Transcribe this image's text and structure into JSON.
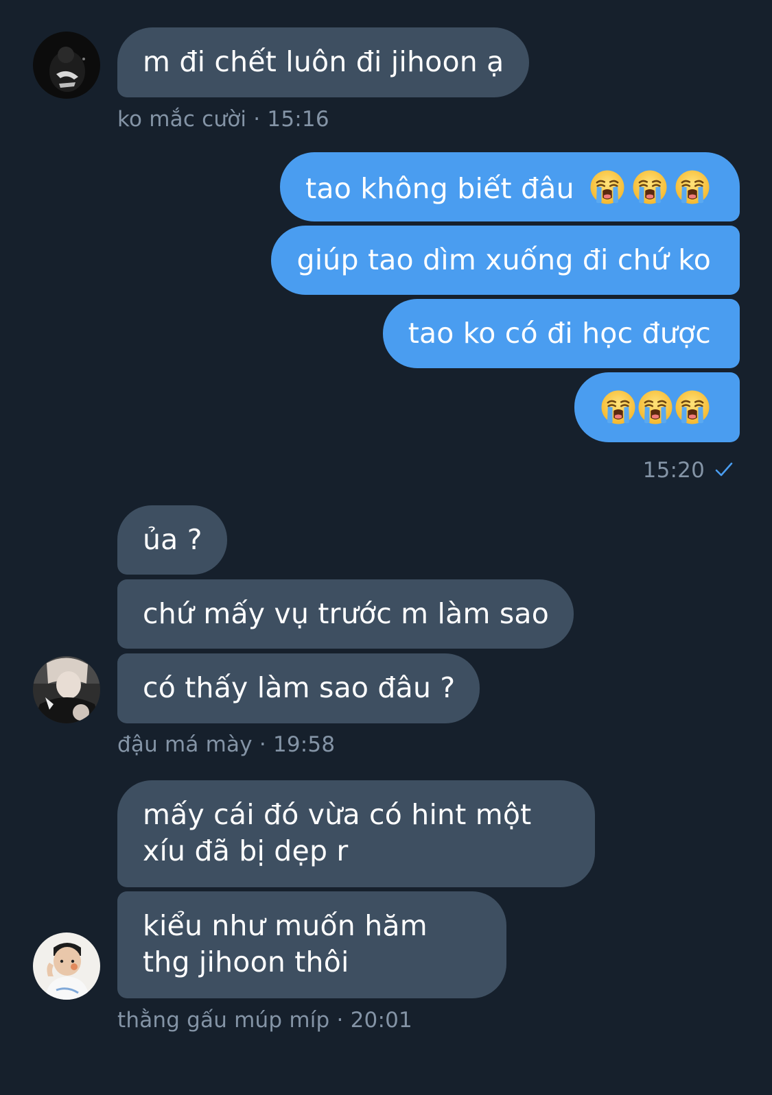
{
  "messages": {
    "m1": {
      "text": "m đi chết luôn đi jihoon ạ",
      "sender": "ko mắc cười",
      "time": "15:16"
    },
    "m2": {
      "text": "tao không biết đâu",
      "emoji": [
        "loudly-crying-face",
        "loudly-crying-face",
        "loudly-crying-face"
      ]
    },
    "m3": {
      "text": "giúp tao dìm xuống đi chứ ko"
    },
    "m4": {
      "text": "tao ko có đi học được"
    },
    "m5": {
      "emoji": [
        "loudly-crying-face",
        "loudly-crying-face",
        "loudly-crying-face"
      ],
      "time": "15:20",
      "status": "sent-check"
    },
    "m6": {
      "text": "ủa ?"
    },
    "m7": {
      "text": "chứ mấy vụ trước m làm sao"
    },
    "m8": {
      "text": "có thấy làm sao đâu ?",
      "sender": "đậu má mày ",
      "time": "19:58"
    },
    "m9": {
      "text": "mấy cái đó vừa có hint một xíu đã bị dẹp r"
    },
    "m10": {
      "text": "kiểu như muốn hăm thg jihoon thôi",
      "sender": "thằng gấu múp míp",
      "time": "20:01"
    }
  },
  "separator": " · ",
  "colors": {
    "background": "#16202c",
    "incoming_bubble": "#3e4f61",
    "outgoing_bubble": "#4a9df0",
    "meta_text": "#8494a6",
    "check": "#4a9df0"
  }
}
